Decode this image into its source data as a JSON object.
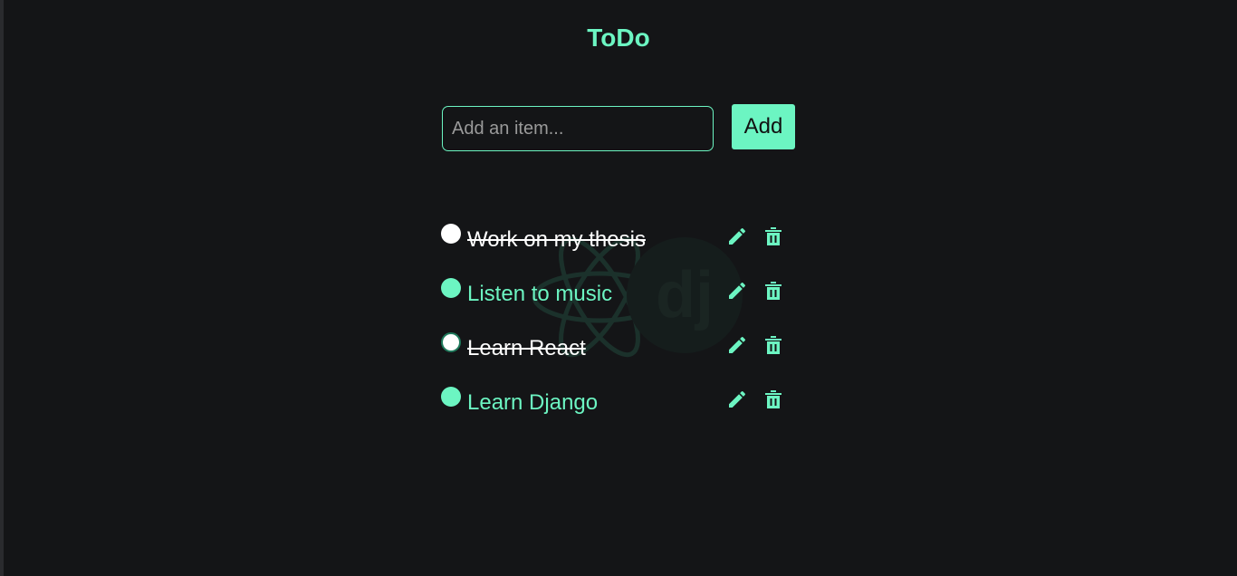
{
  "app": {
    "title": "ToDo"
  },
  "form": {
    "placeholder": "Add an item...",
    "value": "",
    "add_label": "Add"
  },
  "items": [
    {
      "label": "Work on my thesis",
      "completed": true
    },
    {
      "label": "Listen to music",
      "completed": false
    },
    {
      "label": "Learn React",
      "completed": true
    },
    {
      "label": "Learn Django",
      "completed": false
    }
  ],
  "watermark": {
    "text": "dj"
  },
  "icons": {
    "edit": "pencil-icon",
    "delete": "trash-icon"
  },
  "colors": {
    "accent": "#6cf5c2",
    "background": "#141517",
    "completed_text": "#ffffff"
  }
}
